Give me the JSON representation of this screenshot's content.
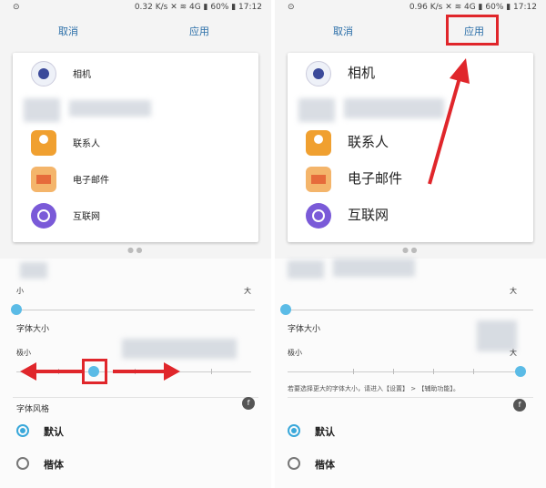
{
  "left": {
    "status": {
      "left": "⊙",
      "right": "0.32 K/s ✕ ≋ 4G ▮ 60% ▮ 17:12"
    },
    "topbar": {
      "cancel": "取消",
      "apply": "应用"
    },
    "apps": [
      "相机",
      "",
      "联系人",
      "电子邮件",
      "互联网"
    ],
    "slider1": {
      "min": "小",
      "max": "大"
    },
    "font_size_label": "字体大小",
    "size_min": "极小",
    "font_style_label": "字体风格",
    "options": [
      "默认",
      "楷体"
    ],
    "font_icon": "f"
  },
  "right": {
    "status": {
      "left": "⊙",
      "right": "0.96 K/s ✕ ≋ 4G ▮ 60% ▮ 17:12"
    },
    "topbar": {
      "cancel": "取消",
      "apply": "应用"
    },
    "apps": [
      "相机",
      "",
      "联系人",
      "电子邮件",
      "互联网"
    ],
    "slider1": {
      "max": "大"
    },
    "font_size_label": "字体大小",
    "size_min": "极小",
    "size_max": "大",
    "hint": "若要选择更大的字体大小，请进入【设置】 > 【辅助功能】。",
    "options": [
      "默认",
      "楷体"
    ],
    "font_icon": "f"
  },
  "colors": {
    "accent": "#5bbbe6",
    "annotation": "#e0262b",
    "link": "#2a6ea8"
  }
}
